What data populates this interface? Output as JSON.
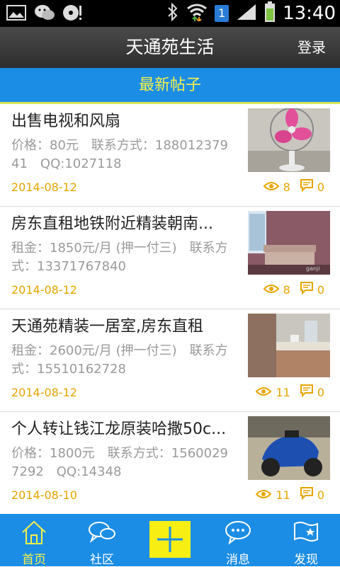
{
  "status_bar": {
    "time": "13:40",
    "sim_badge": "1"
  },
  "header": {
    "title": "天通苑生活",
    "login_label": "登录"
  },
  "section": {
    "title": "最新帖子"
  },
  "posts": [
    {
      "title": "出售电视和风扇",
      "desc": "价格：80元　联系方式：18801237941　QQ:1027118",
      "date": "2014-08-12",
      "views": "8",
      "comments": "0"
    },
    {
      "title": "房东直租地铁附近精装朝南...",
      "desc": "租金：1850元/月 (押一付三)　联系方式：13371767840",
      "date": "2014-08-12",
      "views": "8",
      "comments": "0"
    },
    {
      "title": "天通苑精装一居室,房东直租",
      "desc": "租金：2600元/月 (押一付三)　联系方式：15510162728",
      "date": "2014-08-12",
      "views": "11",
      "comments": "0"
    },
    {
      "title": "个人转让钱江龙原装哈撒50c...",
      "desc": "价格：1800元　联系方式：15600297292　QQ:14348",
      "date": "2014-08-10",
      "views": "11",
      "comments": "0"
    }
  ],
  "nav": {
    "home": "首页",
    "community": "社区",
    "messages": "消息",
    "discover": "发现"
  },
  "colors": {
    "accent_blue": "#1c8de4",
    "highlight_yellow": "#f5f14a",
    "date_orange": "#e7a400"
  }
}
